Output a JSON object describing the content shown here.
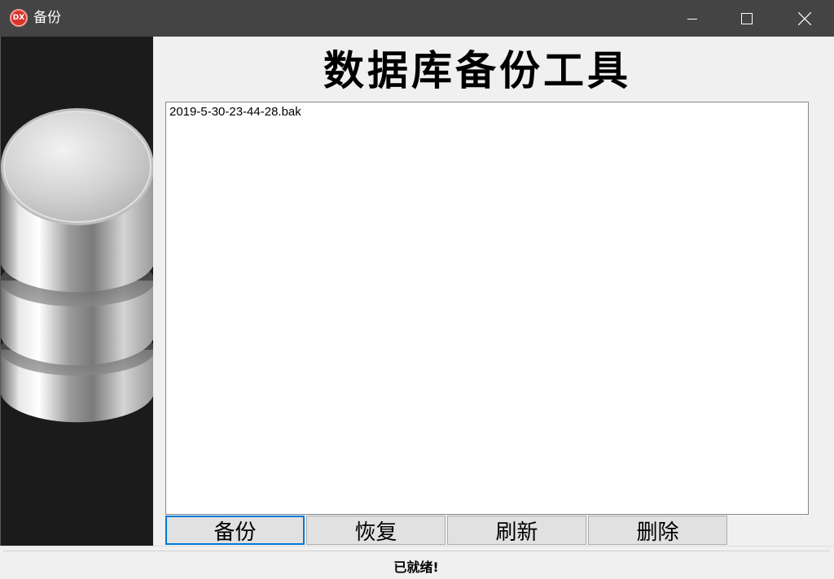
{
  "window": {
    "title": "备份",
    "icon_text": "DX",
    "icon_color": "#d8362b",
    "controls": [
      "minimize",
      "maximize",
      "close"
    ]
  },
  "header": {
    "title": "数据库备份工具"
  },
  "file_list": {
    "items": [
      "2019-5-30-23-44-28.bak"
    ]
  },
  "buttons": {
    "backup": "备份",
    "restore": "恢复",
    "refresh": "刷新",
    "delete": "删除"
  },
  "status": {
    "text": "已就绪!"
  },
  "colors": {
    "titlebar": "#444444",
    "side_panel": "#1b1b1b",
    "focus_border": "#0078d7"
  }
}
